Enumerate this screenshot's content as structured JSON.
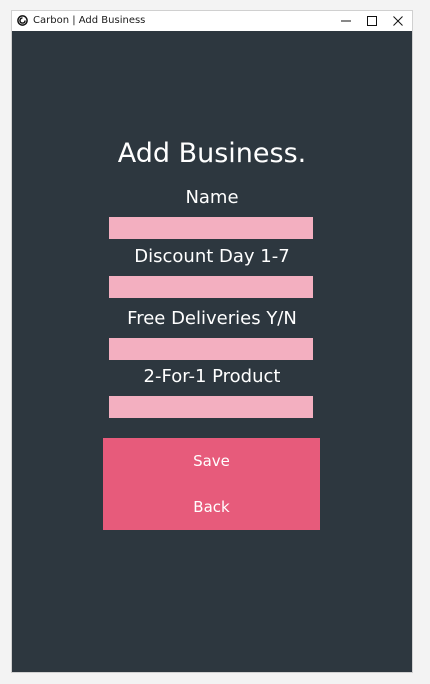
{
  "window": {
    "title": "Carbon | Add Business",
    "app_icon": "carbon-logo-icon",
    "controls": {
      "minimize_icon": "minimize-icon",
      "maximize_icon": "maximize-icon",
      "close_icon": "close-icon"
    }
  },
  "form": {
    "heading": "Add Business.",
    "fields": [
      {
        "label": "Name",
        "value": ""
      },
      {
        "label": "Discount Day 1-7",
        "value": ""
      },
      {
        "label": "Free Deliveries Y/N",
        "value": ""
      },
      {
        "label": "2-For-1 Product",
        "value": ""
      }
    ],
    "buttons": {
      "save_label": "Save",
      "back_label": "Back"
    }
  },
  "colors": {
    "background": "#2d373f",
    "input_fill": "#f3afc0",
    "button_fill": "#e75b7b",
    "text": "#ffffff"
  }
}
